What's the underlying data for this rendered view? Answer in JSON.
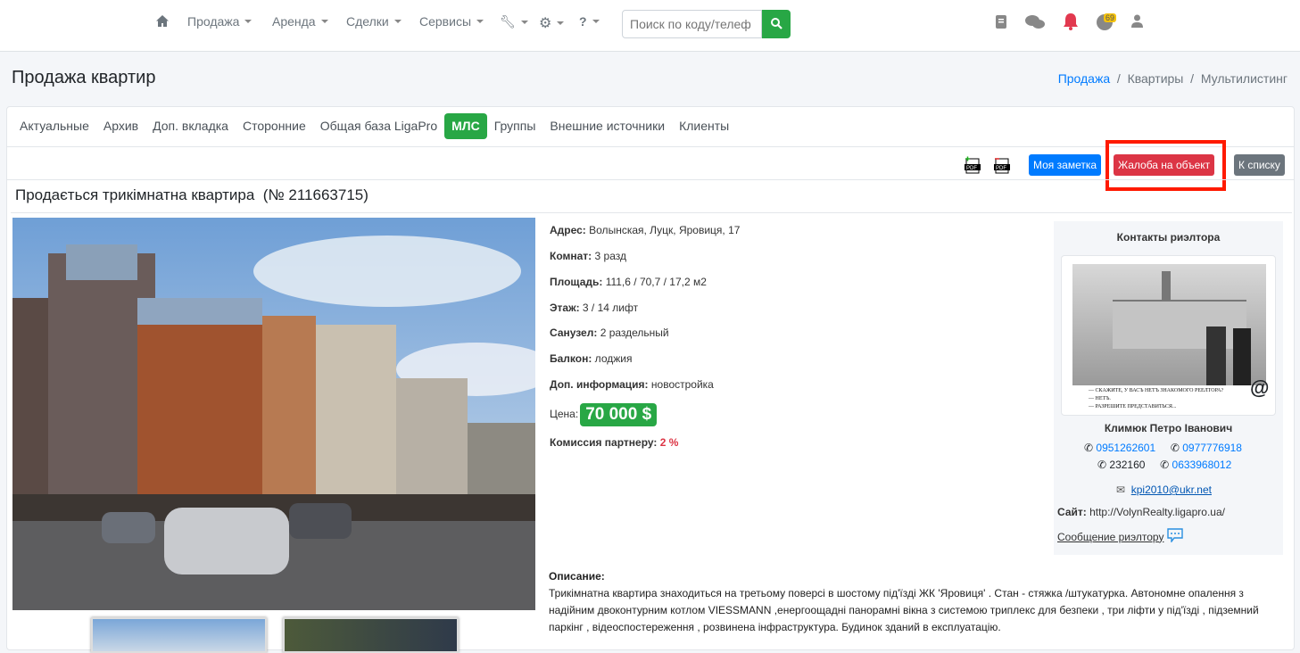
{
  "nav": {
    "items": [
      "Продажа",
      "Аренда",
      "Сделки",
      "Сервисы"
    ],
    "search_placeholder": "Поиск по коду/телеф",
    "badge": "69"
  },
  "page": {
    "title": "Продажа квартир",
    "breadcrumb": [
      "Продажа",
      "Квартиры",
      "Мультилистинг"
    ],
    "sep": "/"
  },
  "tabs": [
    "Актуальные",
    "Архив",
    "Доп. вкладка",
    "Сторонние",
    "Общая база LigaPro",
    "МЛС",
    "Группы",
    "Внешние источники",
    "Клиенты"
  ],
  "toolbar": {
    "note": "Моя заметка",
    "complaint": "Жалоба на объект",
    "back": "К списку"
  },
  "listing": {
    "title": "Продається трикімнатна квартира  (№ 211663715)",
    "fields": [
      {
        "label": "Адрес:",
        "value": " Волынская, Луцк, Яровиця, 17"
      },
      {
        "label": "Комнат:",
        "value": " 3 разд"
      },
      {
        "label": "Площадь:",
        "value": " 111,6 / 70,7 / 17,2 м2"
      },
      {
        "label": "Этаж:",
        "value": " 3 / 14 лифт"
      },
      {
        "label": "Санузел:",
        "value": " 2 раздельный"
      },
      {
        "label": "Балкон:",
        "value": " лоджия"
      },
      {
        "label": "Доп. информация:",
        "value": " новостройка"
      }
    ],
    "price_label": "Цена:",
    "price": "70 000 $",
    "commission_label": "Комиссия партнеру:",
    "commission": " 2 %",
    "desc_label": "Описание:",
    "description": "Трикімнатна квартира знаходиться на третьому поверсі в шостому під'їзді ЖК 'Яровиця' . Стан - стяжка /штукатурка. Автономне опалення з надійним двоконтурним котлом VIESSMANN ,енергоощадні панорамні вікна з системою триплекс для безпеки , три ліфти у під'їзді , підземний паркінг , відеоспостереження , розвинена інфраструктура. Будинок зданий в експлуатацію."
  },
  "contact": {
    "heading": "Контакты риэлтора",
    "name": "Климюк Петро Іванович",
    "phones": [
      "0951262601",
      "0977776918",
      "232160",
      "0633968012"
    ],
    "email": "kpi2010@ukr.net",
    "site_label": "Сайт:",
    "site": " http://VolynRealty.ligapro.ua/",
    "message": "Сообщение риэлтору",
    "image_caption": [
      "— СКАЖИТЕ, У ВАСЪ НЕТЪ ЗНАКОМОГО РЕЕЛТОРА?",
      "— НЕТЪ.",
      "— РАЗРЕШИТЕ ПРЕДСТАВИТЬСЯ..."
    ]
  }
}
